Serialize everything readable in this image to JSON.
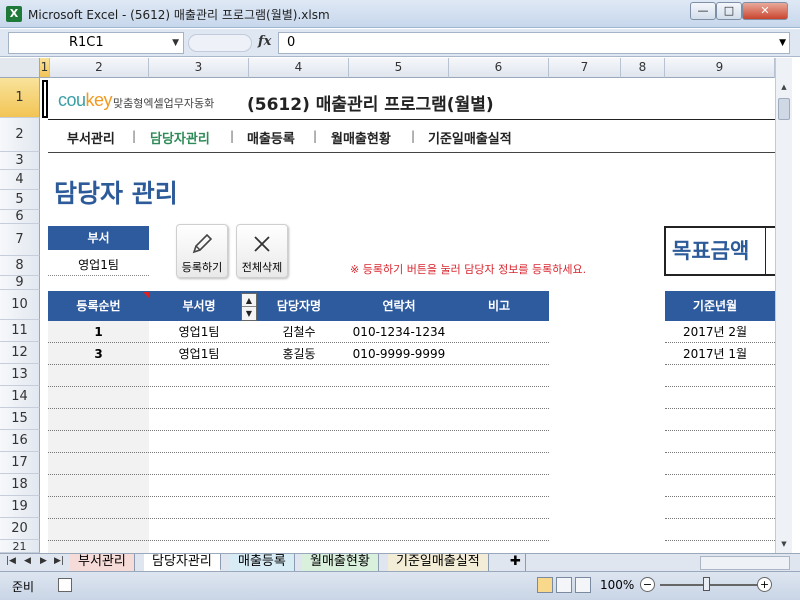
{
  "window": {
    "title": "Microsoft Excel - (5612) 매출관리 프로그램(월별).xlsm",
    "app_icon": "X",
    "btn_min": "—",
    "btn_max": "□",
    "btn_close": "✕"
  },
  "formula": {
    "name_box": "R1C1",
    "value": "0",
    "fx": "fx"
  },
  "columns": [
    "1",
    "2",
    "3",
    "4",
    "5",
    "6",
    "7",
    "8",
    "9"
  ],
  "rows": [
    "1",
    "2",
    "3",
    "4",
    "5",
    "6",
    "7",
    "8",
    "9",
    "10",
    "11",
    "12",
    "13",
    "14",
    "15",
    "16",
    "17",
    "18",
    "19",
    "20",
    "21"
  ],
  "header": {
    "logo_main": "cou",
    "logo_accent": "key",
    "logo_sub": "맞춤형엑셀업무자동화",
    "title": "(5612) 매출관리 프로그램(월별)"
  },
  "nav": [
    "부서관리",
    "담당자관리",
    "매출등록",
    "월매출현황",
    "기준일매출실적"
  ],
  "nav_sep": "|",
  "section_title": "담당자 관리",
  "dept_filter": {
    "label": "부서",
    "value": "영업1팀"
  },
  "buttons": {
    "register": "등록하기",
    "delete_all": "전체삭제"
  },
  "note": "※ 등록하기 버튼을 눌러 담당자 정보를 등록하세요.",
  "target_label": "목표금액",
  "table": {
    "headers": [
      "등록순번",
      "부서명",
      "담당자명",
      "연락처",
      "비고"
    ],
    "rows": [
      [
        "1",
        "영업1팀",
        "김철수",
        "010-1234-1234",
        ""
      ],
      [
        "3",
        "영업1팀",
        "홍길동",
        "010-9999-9999",
        ""
      ]
    ]
  },
  "side_table": {
    "header": "기준년월",
    "rows": [
      "2017년 2월",
      "2017년 1월"
    ]
  },
  "sheet_tabs": [
    "부서관리",
    "담당자관리",
    "매출등록",
    "월매출현황",
    "기준일매출실적"
  ],
  "tab_nav": [
    "|◀",
    "◀",
    "▶",
    "▶|"
  ],
  "status": {
    "ready": "준비",
    "zoom": "100%",
    "zoom_minus": "−",
    "zoom_plus": "+"
  },
  "colors": {
    "accent_blue": "#2e5b9e",
    "nav_active": "#2e8b57",
    "note_red": "#d9262f"
  }
}
